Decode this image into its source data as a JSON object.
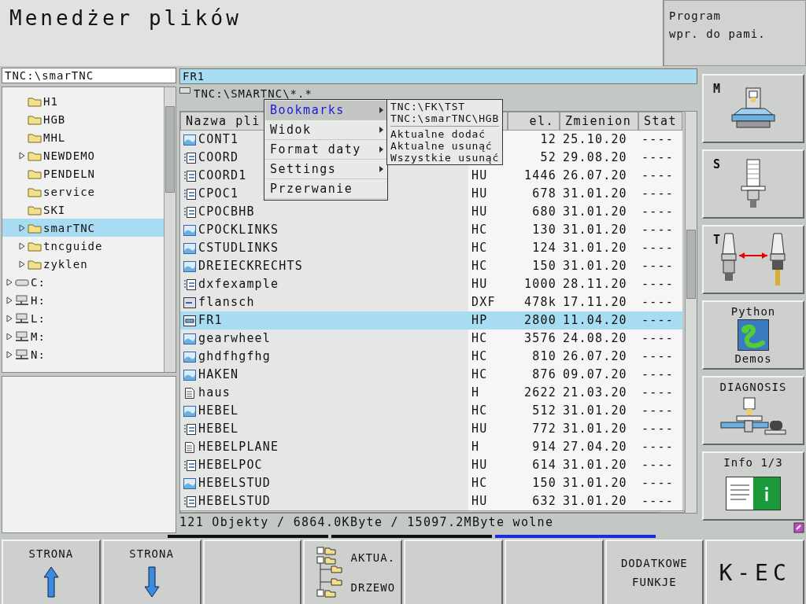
{
  "title": "Menedżer plików",
  "mode_box": {
    "lines": [
      "Program",
      "wpr. do pami."
    ]
  },
  "tree_path": "TNC:\\smarTNC",
  "tree": [
    {
      "children": [
        {
          "label": "H1",
          "kind": "folder",
          "expandable": false,
          "selected": false
        },
        {
          "label": "HGB",
          "kind": "folder",
          "expandable": false,
          "selected": false
        },
        {
          "label": "MHL",
          "kind": "folder",
          "expandable": false,
          "selected": false
        },
        {
          "label": "NEWDEMO",
          "kind": "folder",
          "expandable": true,
          "selected": false
        },
        {
          "label": "PENDELN",
          "kind": "folder",
          "expandable": false,
          "selected": false
        },
        {
          "label": "service",
          "kind": "folder",
          "expandable": false,
          "selected": false
        },
        {
          "label": "SKI",
          "kind": "folder",
          "expandable": false,
          "selected": false
        },
        {
          "label": "smarTNC",
          "kind": "folder",
          "expandable": true,
          "selected": true
        },
        {
          "label": "tncguide",
          "kind": "folder",
          "expandable": true,
          "selected": false
        },
        {
          "label": "zyklen",
          "kind": "folder",
          "expandable": true,
          "selected": false
        }
      ]
    },
    {
      "label": "C:",
      "kind": "disk",
      "expandable": true,
      "selected": false
    },
    {
      "label": "H:",
      "kind": "network",
      "expandable": true,
      "selected": false
    },
    {
      "label": "L:",
      "kind": "network",
      "expandable": true,
      "selected": false
    },
    {
      "label": "M:",
      "kind": "network",
      "expandable": true,
      "selected": false
    },
    {
      "label": "N:",
      "kind": "network",
      "expandable": true,
      "selected": false
    }
  ],
  "file_field": {
    "value": "FR1"
  },
  "list_path": "TNC:\\SMARTNC\\*.*",
  "columns": [
    {
      "label": "Nazwa pli"
    },
    {
      "label": "el."
    },
    {
      "label": "Zmienion"
    },
    {
      "label": "Stat"
    }
  ],
  "rows": [
    {
      "name": "CONT1",
      "kind": "contour",
      "size": "12",
      "date": "25.10.20",
      "status": "----",
      "selected": false
    },
    {
      "name": "COORD",
      "kind": "program",
      "size": "52",
      "date": "29.08.20",
      "status": "----",
      "selected": false
    },
    {
      "name": "COORD1",
      "kind": "program",
      "type": "HU",
      "size": "1446",
      "date": "26.07.20",
      "status": "----",
      "selected": false
    },
    {
      "name": "CPOC1",
      "kind": "program",
      "type": "HU",
      "size": "678",
      "date": "31.01.20",
      "status": "----",
      "selected": false
    },
    {
      "name": "CPOCBHB",
      "kind": "program",
      "type": "HU",
      "size": "680",
      "date": "31.01.20",
      "status": "----",
      "selected": false
    },
    {
      "name": "CPOCKLINKS",
      "kind": "contour",
      "type": "HC",
      "size": "130",
      "date": "31.01.20",
      "status": "----",
      "selected": false
    },
    {
      "name": "CSTUDLINKS",
      "kind": "contour",
      "type": "HC",
      "size": "124",
      "date": "31.01.20",
      "status": "----",
      "selected": false
    },
    {
      "name": "DREIECKRECHTS",
      "kind": "contour",
      "type": "HC",
      "size": "150",
      "date": "31.01.20",
      "status": "----",
      "selected": false
    },
    {
      "name": "dxfexample",
      "kind": "program",
      "type": "HU",
      "size": "1000",
      "date": "28.11.20",
      "status": "----",
      "selected": false
    },
    {
      "name": "flansch",
      "kind": "dxf",
      "type": "DXF",
      "size": "478k",
      "date": "17.11.20",
      "status": "----",
      "selected": false
    },
    {
      "name": "FR1",
      "kind": "pallet",
      "type": "HP",
      "size": "2800",
      "date": "11.04.20",
      "status": "----",
      "selected": true
    },
    {
      "name": "gearwheel",
      "kind": "contour",
      "type": "HC",
      "size": "3576",
      "date": "24.08.20",
      "status": "----",
      "selected": false
    },
    {
      "name": "ghdfhgfhg",
      "kind": "contour",
      "type": "HC",
      "size": "810",
      "date": "26.07.20",
      "status": "----",
      "selected": false
    },
    {
      "name": "HAKEN",
      "kind": "contour",
      "type": "HC",
      "size": "876",
      "date": "09.07.20",
      "status": "----",
      "selected": false
    },
    {
      "name": "haus",
      "kind": "text",
      "type": "H",
      "size": "2622",
      "date": "21.03.20",
      "status": "----",
      "selected": false
    },
    {
      "name": "HEBEL",
      "kind": "contour",
      "type": "HC",
      "size": "512",
      "date": "31.01.20",
      "status": "----",
      "selected": false
    },
    {
      "name": "HEBEL",
      "kind": "program",
      "type": "HU",
      "size": "772",
      "date": "31.01.20",
      "status": "----",
      "selected": false
    },
    {
      "name": "HEBELPLANE",
      "kind": "text",
      "type": "H",
      "size": "914",
      "date": "27.04.20",
      "status": "----",
      "selected": false
    },
    {
      "name": "HEBELPOC",
      "kind": "program",
      "type": "HU",
      "size": "614",
      "date": "31.01.20",
      "status": "----",
      "selected": false
    },
    {
      "name": "HEBELSTUD",
      "kind": "contour",
      "type": "HC",
      "size": "150",
      "date": "31.01.20",
      "status": "----",
      "selected": false
    },
    {
      "name": "HEBELSTUD",
      "kind": "program",
      "type": "HU",
      "size": "632",
      "date": "31.01.20",
      "status": "----",
      "selected": false
    }
  ],
  "status": "121 Objekty / 6864.0KByte / 15097.2MByte wolne",
  "menu": [
    {
      "label": "Bookmarks",
      "has_submenu": true,
      "selected": true
    },
    {
      "label": "Widok",
      "has_submenu": true,
      "selected": false
    },
    {
      "label": "Format daty",
      "has_submenu": true,
      "selected": false
    },
    {
      "label": "Settings",
      "has_submenu": true,
      "selected": false
    },
    {
      "label": "Przerwanie",
      "has_submenu": false,
      "selected": false
    }
  ],
  "submenu": {
    "bookmarks": [
      "TNC:\\FK\\TST",
      "TNC:\\smarTNC\\HGB"
    ],
    "actions": [
      "Aktualne dodać",
      "Aktualne usunąć",
      "Wszystkie usunąć"
    ]
  },
  "side_keys": [
    {
      "kind": "machine",
      "lines": [
        "M"
      ]
    },
    {
      "kind": "spindle",
      "lines": [
        "S"
      ]
    },
    {
      "kind": "tool-change",
      "lines": [
        "T"
      ]
    },
    {
      "kind": "python",
      "lines": [
        "Python",
        "Demos"
      ]
    },
    {
      "kind": "diagnosis",
      "lines": [
        "DIAGNOSIS"
      ]
    },
    {
      "kind": "info",
      "lines": [
        "Info 1/3"
      ]
    }
  ],
  "soft_keys": [
    {
      "kind": "page-up",
      "lines": [
        "STRONA"
      ]
    },
    {
      "kind": "page-down",
      "lines": [
        "STRONA"
      ]
    },
    {
      "kind": "empty"
    },
    {
      "kind": "tree",
      "lines": [
        "AKTUA.",
        "DRZEWO"
      ]
    },
    {
      "kind": "empty"
    },
    {
      "kind": "empty"
    },
    {
      "kind": "text",
      "lines": [
        "DODATKOWE",
        "FUNKJE"
      ]
    },
    {
      "kind": "big",
      "lines": [
        "K-EC"
      ]
    }
  ]
}
